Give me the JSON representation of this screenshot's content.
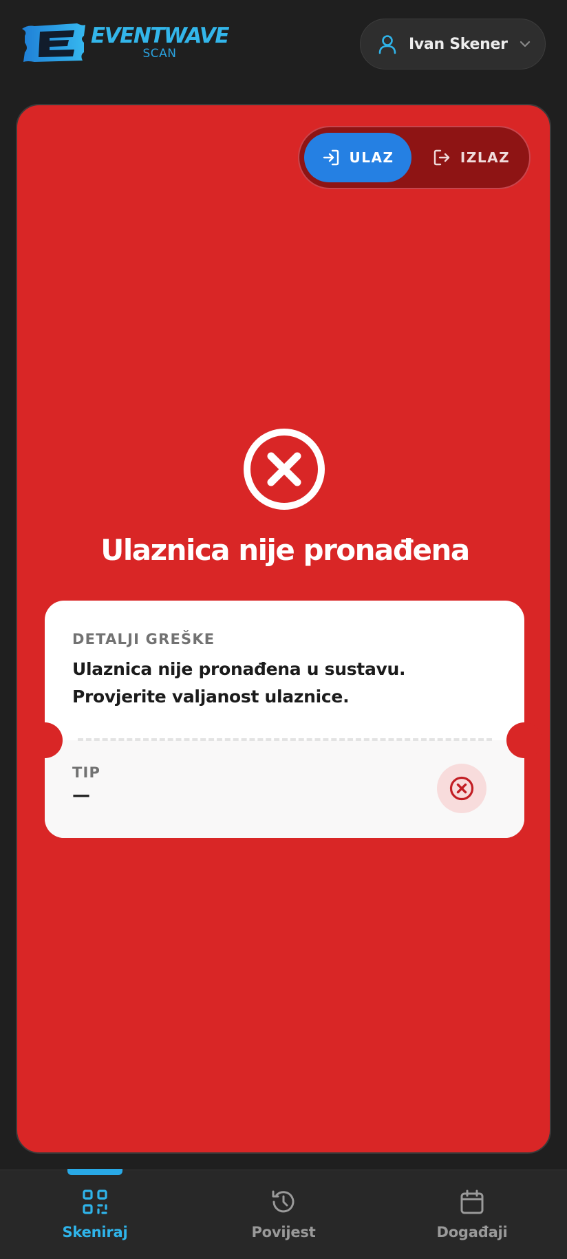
{
  "header": {
    "logo_name": "EVENTWAVE",
    "logo_sub": "SCAN",
    "user_name": "Ivan Skener",
    "icons": [
      "logo-icon",
      "user-icon",
      "chevron-down-icon"
    ]
  },
  "mode_toggle": {
    "entry_label": "ULAZ",
    "exit_label": "IZLAZ",
    "active": "entry"
  },
  "result": {
    "status": "error",
    "title": "Ulaznica nije pronađena",
    "details_label": "DETALJI GREŠKE",
    "details_text": "Ulaznica nije pronađena u sustavu. Provjerite valjanost ulaznice.",
    "type_label": "TIP",
    "type_value": "—"
  },
  "nav": {
    "items": [
      {
        "label": "Skeniraj",
        "icon": "qr-scan-icon",
        "active": true
      },
      {
        "label": "Povijest",
        "icon": "history-icon",
        "active": false
      },
      {
        "label": "Događaji",
        "icon": "calendar-icon",
        "active": false
      }
    ]
  },
  "colors": {
    "background": "#1f1f1f",
    "error_card": "#d92626",
    "accent_blue": "#2580e3",
    "accent_cyan": "#2fb4ea"
  }
}
